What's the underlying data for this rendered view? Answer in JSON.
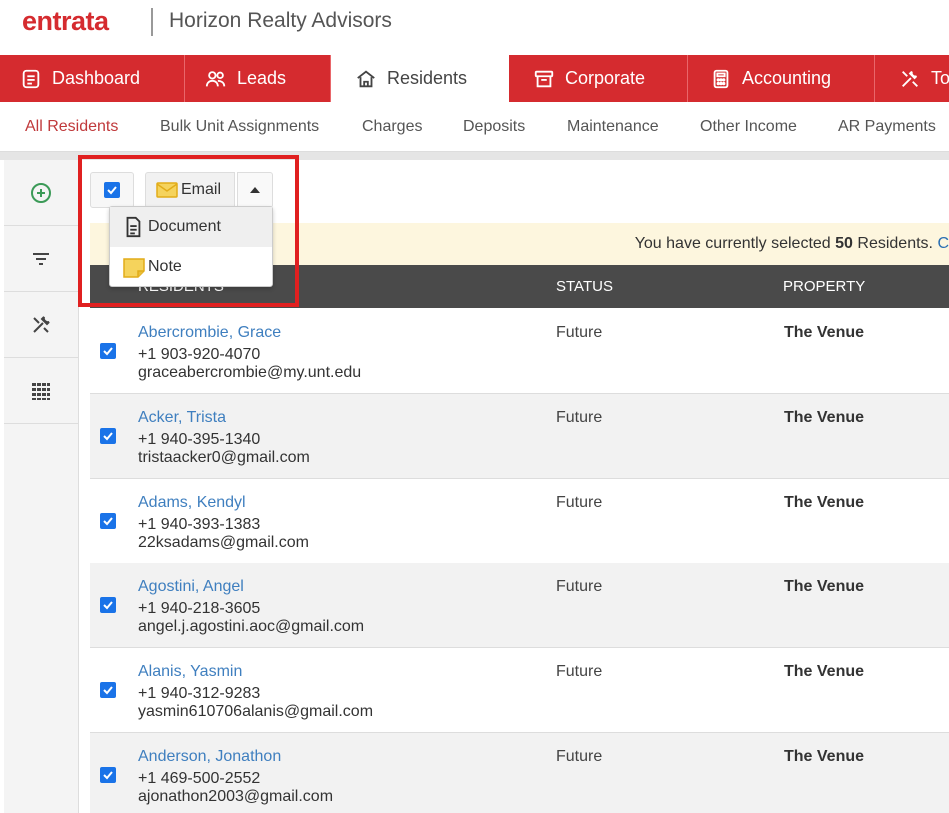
{
  "brand": {
    "logo": "entrata",
    "company": "Horizon Realty Advisors",
    "accent": "#d52b2f"
  },
  "main_nav": [
    {
      "label": "Dashboard",
      "icon": "dashboard-icon"
    },
    {
      "label": "Leads",
      "icon": "people-icon"
    },
    {
      "label": "Residents",
      "icon": "home-icon"
    },
    {
      "label": "Corporate",
      "icon": "archive-icon"
    },
    {
      "label": "Accounting",
      "icon": "calculator-icon"
    },
    {
      "label": "To",
      "icon": "tools-icon"
    }
  ],
  "sub_nav": [
    "All Residents",
    "Bulk Unit Assignments",
    "Charges",
    "Deposits",
    "Maintenance",
    "Other Income",
    "AR Payments"
  ],
  "toolbar": {
    "email_label": "Email"
  },
  "dropdown": [
    {
      "label": "Document",
      "icon": "document-icon"
    },
    {
      "label": "Note",
      "icon": "note-icon"
    }
  ],
  "banner": {
    "prefix": "You have currently selected",
    "count": "50",
    "suffix": "Residents.",
    "link": "C"
  },
  "table": {
    "headers": {
      "residents": "RESIDENTS",
      "status": "STATUS",
      "property": "PROPERTY"
    },
    "rows": [
      {
        "name": "Abercrombie, Grace",
        "phone": "+1 903-920-4070",
        "email": "graceabercrombie@my.unt.edu",
        "status": "Future",
        "property": "The Venue"
      },
      {
        "name": "Acker, Trista",
        "phone": "+1 940-395-1340",
        "email": "tristaacker0@gmail.com",
        "status": "Future",
        "property": "The Venue"
      },
      {
        "name": "Adams, Kendyl",
        "phone": "+1 940-393-1383",
        "email": "22ksadams@gmail.com",
        "status": "Future",
        "property": "The Venue"
      },
      {
        "name": "Agostini, Angel",
        "phone": "+1 940-218-3605",
        "email": "angel.j.agostini.aoc@gmail.com",
        "status": "Future",
        "property": "The Venue"
      },
      {
        "name": "Alanis, Yasmin",
        "phone": "+1 940-312-9283",
        "email": "yasmin610706alanis@gmail.com",
        "status": "Future",
        "property": "The Venue"
      },
      {
        "name": "Anderson, Jonathon",
        "phone": "+1 469-500-2552",
        "email": "ajonathon2003@gmail.com",
        "status": "Future",
        "property": "The Venue"
      }
    ]
  }
}
